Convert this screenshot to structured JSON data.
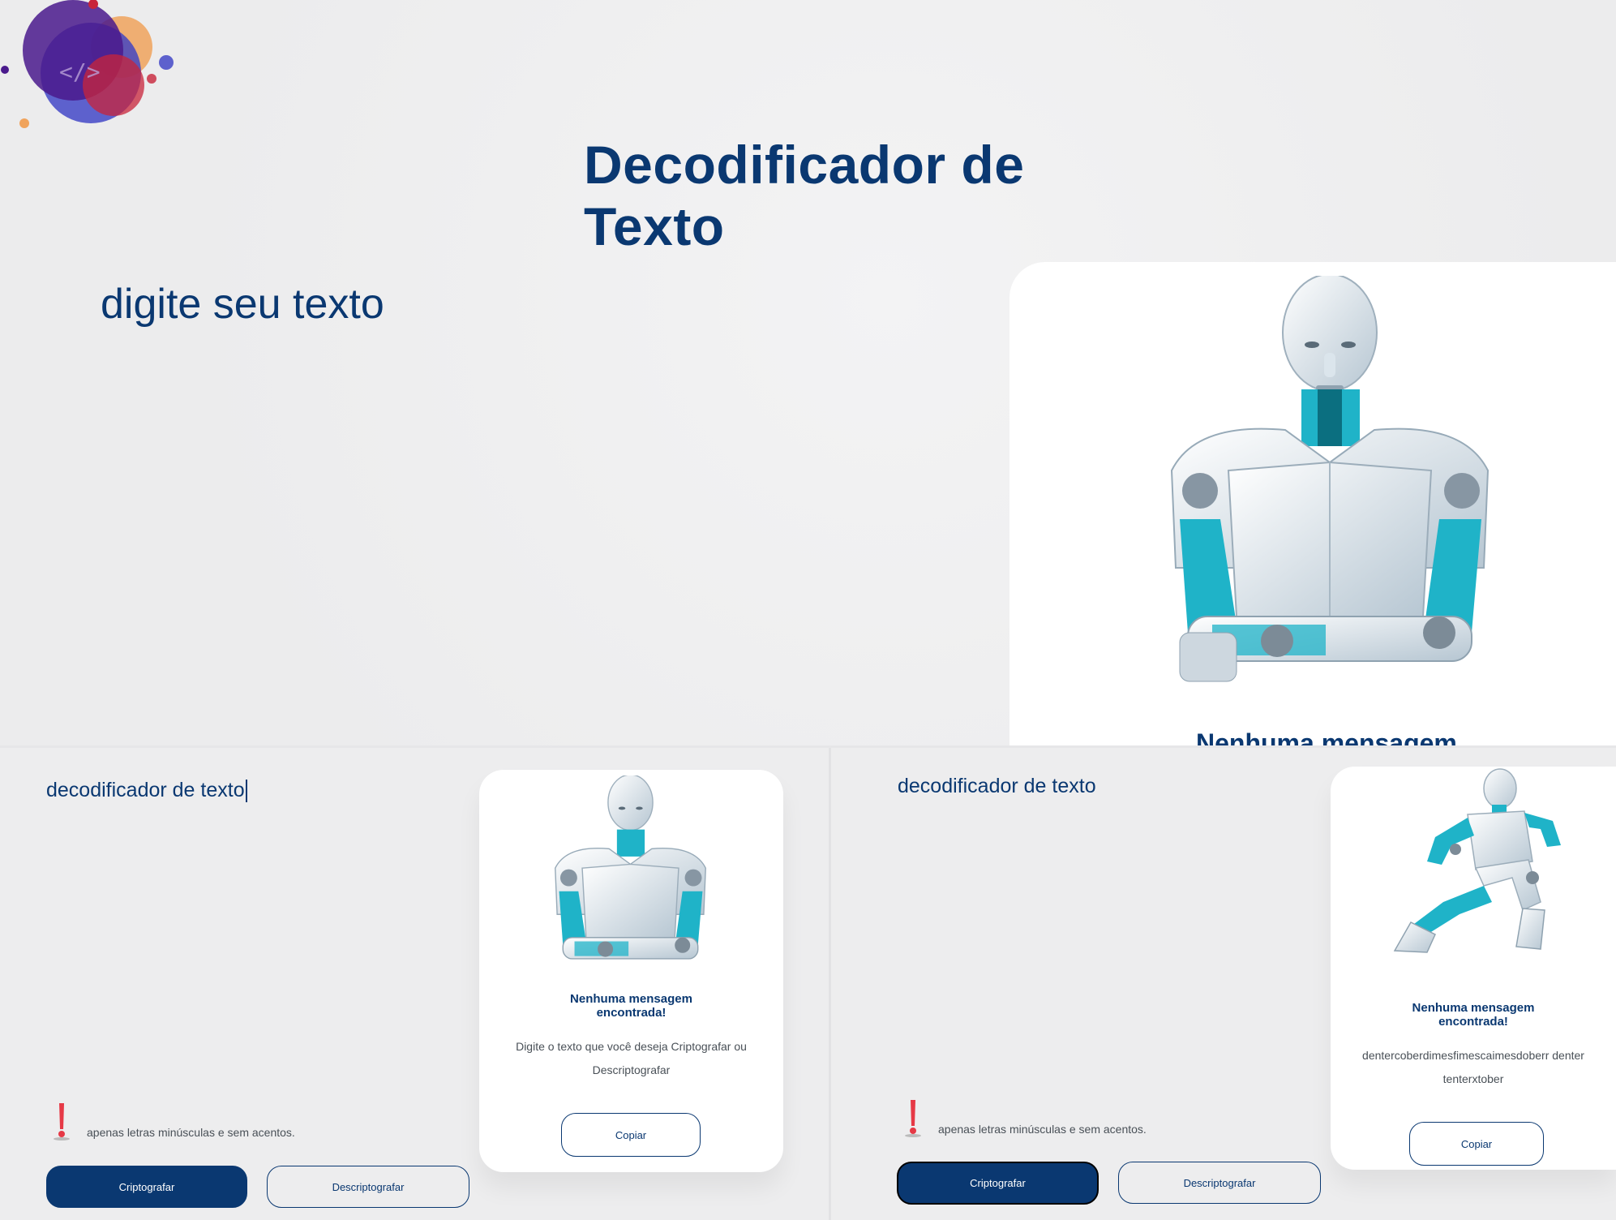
{
  "top": {
    "title": "Decodificador de Texto",
    "placeholder": "digite seu texto",
    "card_title": "Nenhuma mensagem"
  },
  "left": {
    "input_value": "decodificador de texto",
    "hint": "apenas letras minúsculas e sem acentos.",
    "encrypt_label": "Criptografar",
    "decrypt_label": "Descriptografar",
    "card_title_line1": "Nenhuma mensagem",
    "card_title_line2": "encontrada!",
    "card_body_line1": "Digite o texto que você deseja Criptografar ou",
    "card_body_line2": "Descriptografar",
    "copy_label": "Copiar"
  },
  "right": {
    "input_value": "decodificador de texto",
    "hint": "apenas letras minúsculas e sem acentos.",
    "encrypt_label": "Criptografar",
    "decrypt_label": "Descriptografar",
    "card_title_line1": "Nenhuma mensagem",
    "card_title_line2": "encontrada!",
    "card_body_line1": "dentercoberdimesfimescaimesdoberr denter",
    "card_body_line2": "tenterxtober",
    "copy_label": "Copiar"
  },
  "colors": {
    "primary": "#0a3871",
    "background": "#eeeeef",
    "hint_icon": "#e63946",
    "robot_accent": "#2ec4d6"
  },
  "icons": {
    "logo": "code-logo-icon",
    "hint": "exclamation-icon",
    "robot": "robot-illustration"
  }
}
